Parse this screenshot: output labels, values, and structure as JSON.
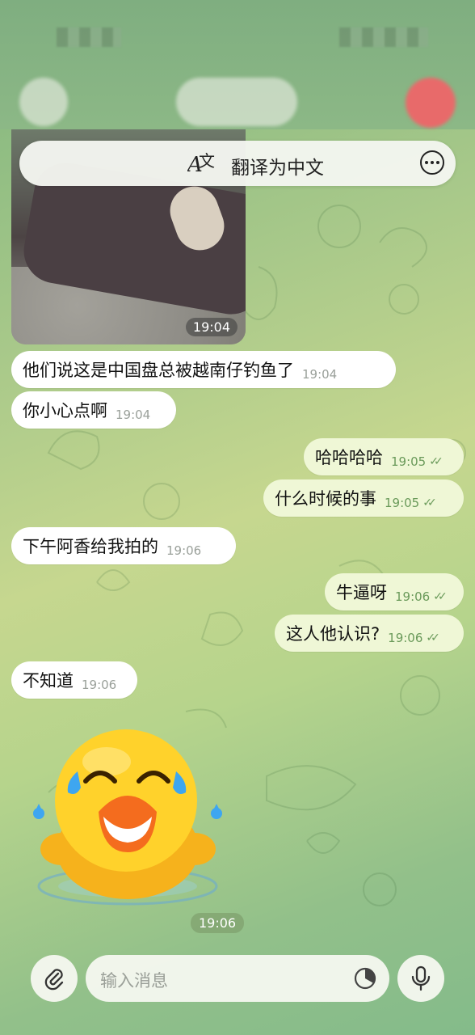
{
  "header": {
    "translate_label": "翻译为中文",
    "translate_icon": "translate-icon",
    "more_icon": "more-icon"
  },
  "photo": {
    "time": "19:04"
  },
  "messages": [
    {
      "dir": "in",
      "text": "他们说这是中国盘总被越南仔钓鱼了",
      "time": "19:04"
    },
    {
      "dir": "in",
      "text": "你小心点啊",
      "time": "19:04"
    },
    {
      "dir": "out",
      "text": "哈哈哈哈",
      "time": "19:05"
    },
    {
      "dir": "out",
      "text": "什么时候的事",
      "time": "19:05"
    },
    {
      "dir": "in",
      "text": "下午阿香给我拍的",
      "time": "19:06"
    },
    {
      "dir": "out",
      "text": "牛逼呀",
      "time": "19:06"
    },
    {
      "dir": "out",
      "text": "这人他认识?",
      "time": "19:06"
    },
    {
      "dir": "in",
      "text": "不知道",
      "time": "19:06"
    }
  ],
  "sticker": {
    "name": "laughing-duck-sticker",
    "time": "19:06"
  },
  "composer": {
    "placeholder": "输入消息",
    "attach_icon": "paperclip-icon",
    "schedule_icon": "clock-icon",
    "mic_icon": "microphone-icon"
  },
  "colors": {
    "incoming_bubble": "#ffffff",
    "outgoing_bubble": "#eff7d6",
    "outgoing_time": "#6a9a5a",
    "background_green": "#a9c98a"
  }
}
